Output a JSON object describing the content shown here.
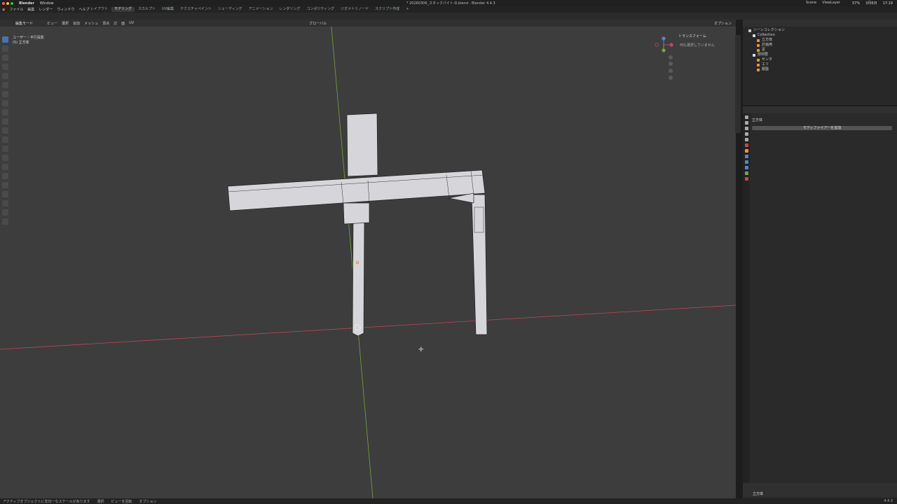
{
  "macbar": {
    "app": "Blender",
    "menu": "Window",
    "date": "3月6日",
    "time": "17:19",
    "battery": "57%"
  },
  "topbar": {
    "menus": [
      "ファイル",
      "編集",
      "レンダー",
      "ウィンドウ",
      "ヘルプ"
    ],
    "workspaces": [
      "レイアウト",
      "モデリング",
      "スカルプト",
      "UV編集",
      "テクスチャペイント",
      "シェーディング",
      "アニメーション",
      "レンダリング",
      "コンポジティング",
      "ジオメトリノード",
      "スクリプト作成"
    ],
    "active_workspace": "モデリング",
    "file_title": "* 20260306_スタックパイト-D.blend - Blender 4.4.3",
    "scene": "Scene",
    "view_layer": "ViewLayer"
  },
  "viewport_header": {
    "mode": "編集モード",
    "menus": [
      "ビュー",
      "選択",
      "追加",
      "メッシュ",
      "頂点",
      "辺",
      "面",
      "UV"
    ],
    "transform_orientation": "グローバル",
    "options": "オプション"
  },
  "viewport": {
    "view_name": "ユーザー・平行投影",
    "object_label": "(5) 立方体",
    "transform_panel_title": "トランスフォーム",
    "transform_panel_msg": "何も選択していません"
  },
  "outliner": {
    "title": "シーンコレクション",
    "rows": [
      {
        "label": "Collection",
        "indent": 1
      },
      {
        "label": "立方体",
        "indent": 2
      },
      {
        "label": "計画用",
        "indent": 2
      },
      {
        "label": "足",
        "indent": 2
      },
      {
        "label": "部材群",
        "indent": 1
      },
      {
        "label": "センタ",
        "indent": 2
      },
      {
        "label": "エリ",
        "indent": 2
      },
      {
        "label": "胴盤",
        "indent": 2
      }
    ]
  },
  "properties": {
    "object_name": "立方体",
    "add_modifier": "モディファイアーを追加",
    "footer_object": "立方体"
  },
  "statusbar": {
    "left": "アクティブオブジェクトに非均一なスケールがあります",
    "select": "選択",
    "rotate": "ビューを回転",
    "options": "オプション",
    "version": "4.4.3"
  },
  "colors": {
    "viewport_bg": "#3d3d3d",
    "x_axis": "#c2455a",
    "y_axis": "#78a33a",
    "active_blue": "#4772b3",
    "mesh_face": "#d6d6da"
  }
}
